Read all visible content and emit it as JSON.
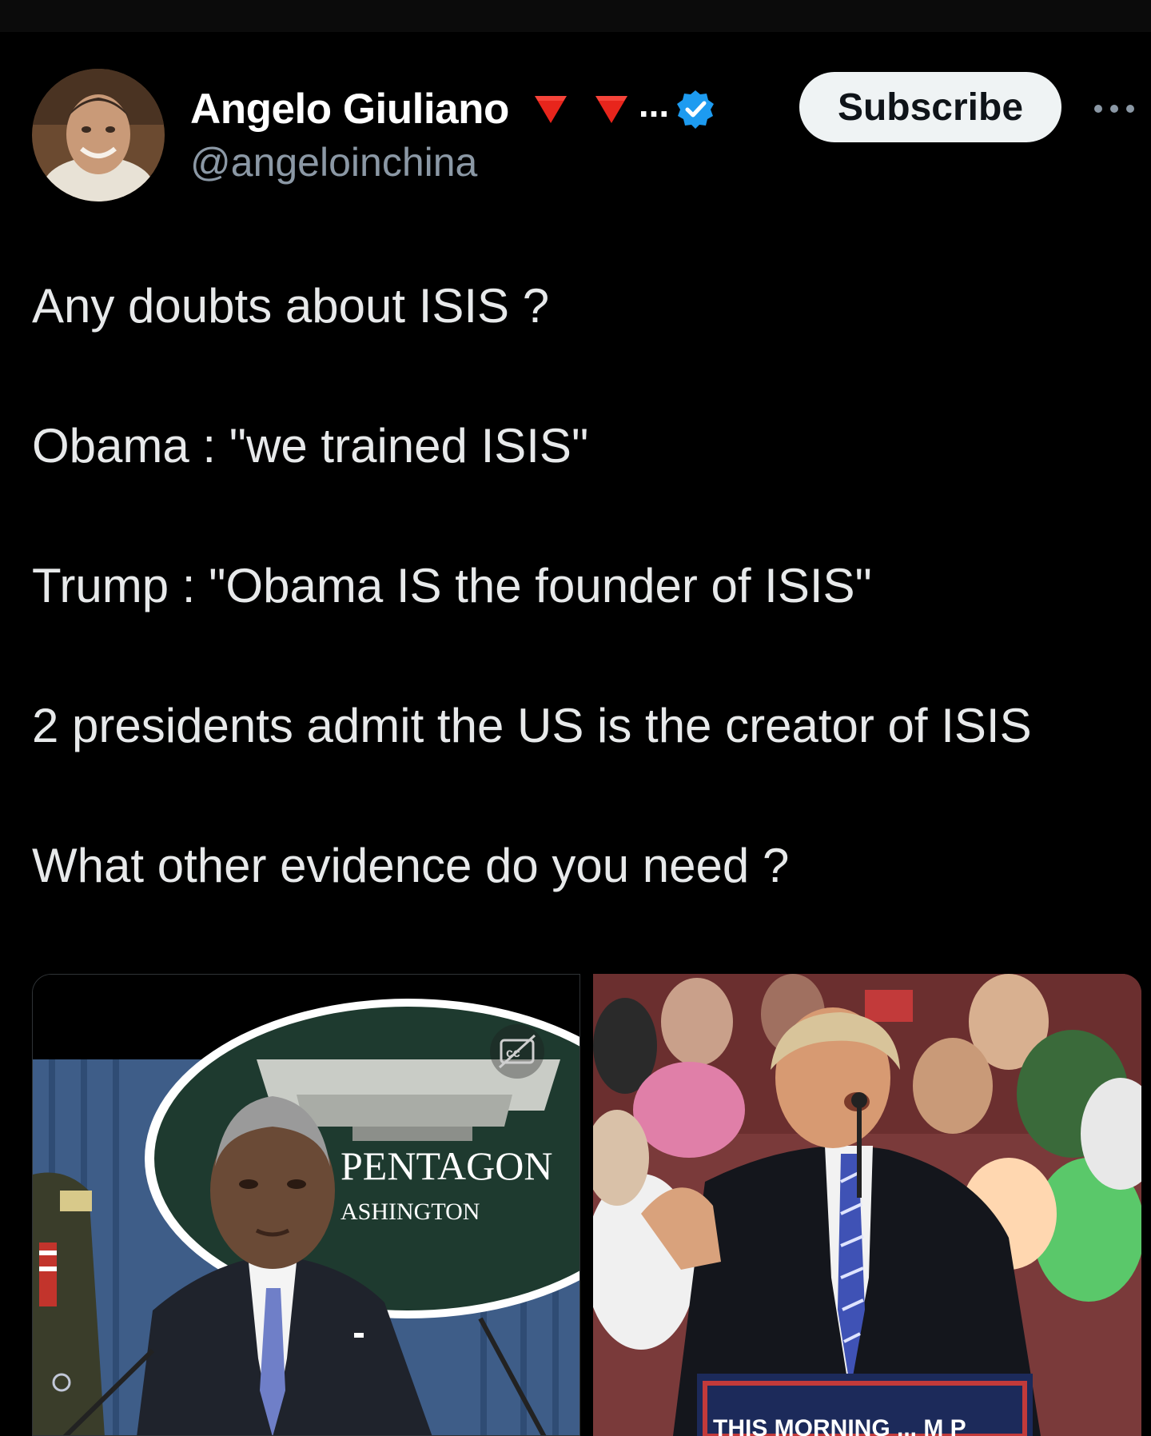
{
  "tweet": {
    "author": {
      "display_name": "Angelo Giuliano",
      "handle": "@angeloinchina",
      "truncation": "...",
      "verified": true
    },
    "subscribe_label": "Subscribe",
    "lines": [
      "Any doubts about ISIS ?",
      "Obama : \"we trained ISIS\"",
      "Trump : \"Obama IS the founder of ISIS\"",
      "2 presidents admit the US is the creator of ISIS",
      "What other evidence do you need ?"
    ],
    "media": [
      {
        "name": "obama-video-still",
        "seal_text_top": "PENTAGON",
        "seal_text_bottom": "ASHINGTON",
        "caption_icon": "closed-captions-icon"
      },
      {
        "name": "trump-rally-video-still",
        "banner_text": "THIS MORNING ... M P"
      }
    ]
  },
  "icons": {
    "flag": "red-triangle-icon",
    "verified": "verified-badge-icon",
    "more": "more-options-icon"
  },
  "colors": {
    "background": "#000000",
    "text": "#e7e9ea",
    "secondary_text": "#8b98a5",
    "verified_blue": "#1d9bf0",
    "flag_red": "#e8251c",
    "button_bg": "#eff3f4"
  }
}
